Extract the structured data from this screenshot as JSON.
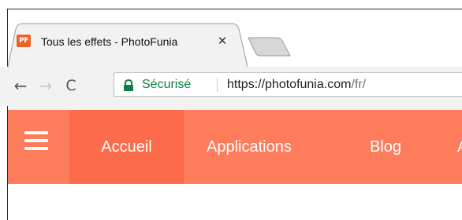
{
  "browser": {
    "tab": {
      "favicon_text": "PF",
      "title": "Tous les effets - PhotoFunia",
      "close_glyph": "✕"
    },
    "toolbar": {
      "back_glyph": "←",
      "forward_glyph": "→",
      "reload_glyph": "C",
      "secure_label": "Sécurisé",
      "url_host": "https://photofunia.com",
      "url_path": "/fr/"
    }
  },
  "site": {
    "accent_color": "#fd7c5c",
    "active_color": "#fc6c4a",
    "nav": {
      "items": [
        {
          "label": "Accueil",
          "active": true
        },
        {
          "label": "Applications"
        },
        {
          "label": "Blog"
        },
        {
          "label": "A"
        }
      ]
    }
  }
}
